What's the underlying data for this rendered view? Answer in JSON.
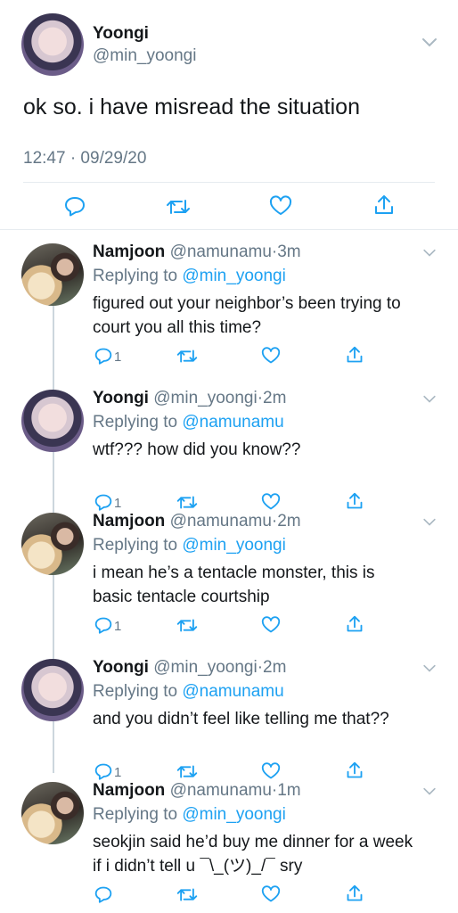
{
  "main_tweet": {
    "name": "Yoongi",
    "handle": "@min_yoongi",
    "text": "ok so. i have misread the situation",
    "timestamp": "12:47 · 09/29/20"
  },
  "replies": [
    {
      "name": "Namjoon",
      "handle": "@namunamu",
      "sep": "·",
      "time": "3m",
      "replying_prefix": "Replying to",
      "replying_to": "@min_yoongi",
      "line1": "figured out your neighbor’s been trying to",
      "line2": "court you all this time?",
      "reply_count": "1"
    },
    {
      "name": "Yoongi",
      "handle": "@min_yoongi",
      "sep": "·",
      "time": "2m",
      "replying_prefix": "Replying to",
      "replying_to": "@namunamu",
      "line1": "wtf??? how did you know??",
      "line2": "",
      "reply_count": "1"
    },
    {
      "name": "Namjoon",
      "handle": "@namunamu",
      "sep": "·",
      "time": "2m",
      "replying_prefix": "Replying to",
      "replying_to": "@min_yoongi",
      "line1": "i mean he’s a tentacle monster, this is",
      "line2": "basic tentacle courtship",
      "reply_count": "1"
    },
    {
      "name": "Yoongi",
      "handle": "@min_yoongi",
      "sep": "·",
      "time": "2m",
      "replying_prefix": "Replying to",
      "replying_to": "@namunamu",
      "line1": "and you didn’t feel like telling me that??",
      "line2": "",
      "reply_count": "1"
    },
    {
      "name": "Namjoon",
      "handle": "@namunamu",
      "sep": "·",
      "time": "1m",
      "replying_prefix": "Replying to",
      "replying_to": "@min_yoongi",
      "line1": "seokjin said he’d buy me dinner for a week",
      "line2": "if i didn’t tell u ¯\\_(ツ)_/¯ sry",
      "reply_count": ""
    }
  ],
  "icons": {
    "reply": "reply-icon",
    "retweet": "retweet-icon",
    "like": "heart-icon",
    "share": "share-icon",
    "more": "chevron-down-icon"
  },
  "colors": {
    "link": "#1da1f2",
    "muted": "#657786",
    "icon": "#1da1f2"
  }
}
